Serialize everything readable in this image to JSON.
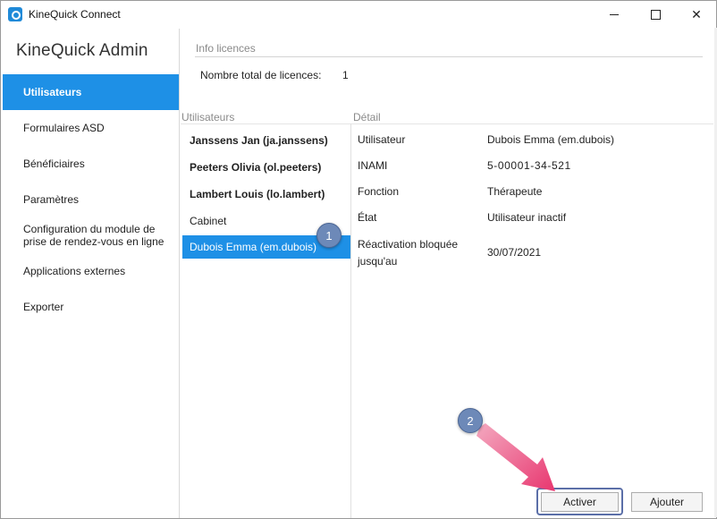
{
  "window": {
    "title": "KineQuick Connect",
    "controls": {
      "minimize": "minimize",
      "maximize": "maximize",
      "close": "✕"
    }
  },
  "sidebar": {
    "title": "KineQuick Admin",
    "items": [
      {
        "label": "Utilisateurs",
        "active": true
      },
      {
        "label": "Formulaires ASD",
        "active": false
      },
      {
        "label": "Bénéficiaires",
        "active": false
      },
      {
        "label": "Paramètres",
        "active": false
      },
      {
        "label": "Configuration du module de prise de rendez-vous en ligne",
        "active": false
      },
      {
        "label": "Applications externes",
        "active": false
      },
      {
        "label": "Exporter",
        "active": false
      }
    ]
  },
  "licences": {
    "section_label": "Info licences",
    "total_label": "Nombre total de licences:",
    "total_value": "1"
  },
  "users": {
    "section_label": "Utilisateurs",
    "list": [
      {
        "label": "Janssens Jan (ja.janssens)",
        "bold": true,
        "selected": false
      },
      {
        "label": "Peeters Olivia (ol.peeters)",
        "bold": true,
        "selected": false
      },
      {
        "label": "Lambert Louis (lo.lambert)",
        "bold": true,
        "selected": false
      },
      {
        "label": "Cabinet",
        "bold": false,
        "selected": false
      },
      {
        "label": "Dubois Emma (em.dubois)",
        "bold": false,
        "selected": true
      }
    ]
  },
  "detail": {
    "section_label": "Détail",
    "fields": [
      {
        "label": "Utilisateur",
        "value": "Dubois Emma (em.dubois)"
      },
      {
        "label": "INAMI",
        "value": "5-00001-34-521"
      },
      {
        "label": "Fonction",
        "value": "Thérapeute"
      },
      {
        "label": "État",
        "value": "Utilisateur inactif"
      },
      {
        "label": "Réactivation bloquée jusqu'au",
        "value": "30/07/2021"
      }
    ]
  },
  "buttons": {
    "activate": "Activer",
    "add": "Ajouter"
  },
  "annotations": {
    "marker1": "1",
    "marker2": "2",
    "arrow_color": "#e8366f",
    "marker_color": "#6d89b8"
  },
  "colors": {
    "accent": "#1e90e6"
  }
}
